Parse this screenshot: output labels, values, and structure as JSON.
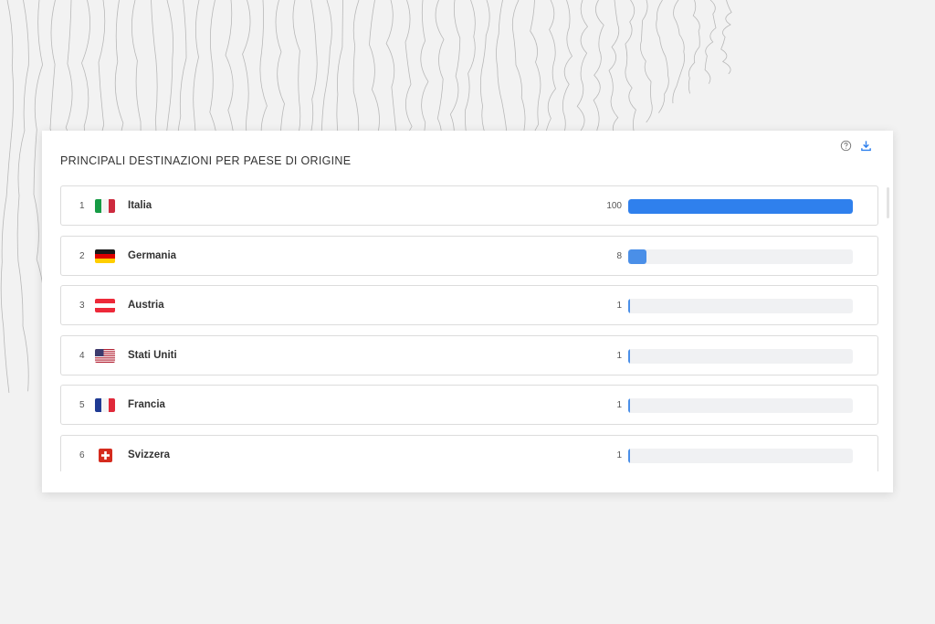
{
  "widget": {
    "title": "PRINCIPALI DESTINAZIONI PER PAESE DI ORIGINE",
    "icons": [
      "help-circle-icon",
      "download-icon"
    ]
  },
  "colors": {
    "bar": "#2f80ed",
    "track": "#f0f1f3"
  },
  "rows": [
    {
      "rank": "1",
      "country": "Italia",
      "flag": "italy-flag-icon",
      "value": "100",
      "level": 1.0
    },
    {
      "rank": "2",
      "country": "Germania",
      "flag": "germany-flag-icon",
      "value": "8",
      "level": 0.08
    },
    {
      "rank": "3",
      "country": "Austria",
      "flag": "austria-flag-icon",
      "value": "1",
      "level": 0.01
    },
    {
      "rank": "4",
      "country": "Stati Uniti",
      "flag": "usa-flag-icon",
      "value": "1",
      "level": 0.01
    },
    {
      "rank": "5",
      "country": "Francia",
      "flag": "france-flag-icon",
      "value": "1",
      "level": 0.01
    },
    {
      "rank": "6",
      "country": "Svizzera",
      "flag": "switzerland-flag-icon",
      "value": "1",
      "level": 0.01
    }
  ]
}
